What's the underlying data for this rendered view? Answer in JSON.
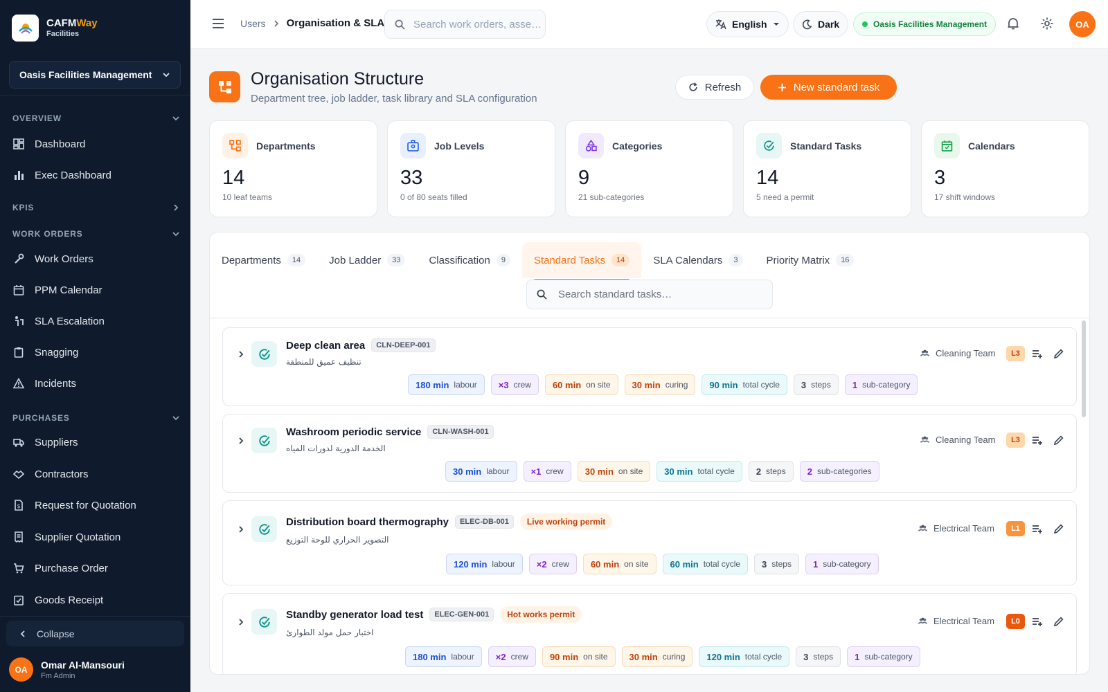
{
  "brand": {
    "name_main": "CAFM",
    "name_accent": "Way",
    "sub": "Facilities"
  },
  "sidebar": {
    "org": "Oasis Facilities Management",
    "sections": {
      "overview": "OVERVIEW",
      "kpis": "KPIS",
      "work_orders": "WORK ORDERS",
      "purchases": "PURCHASES"
    },
    "items": {
      "dashboard": "Dashboard",
      "exec_dashboard": "Exec Dashboard",
      "work_orders": "Work Orders",
      "ppm_calendar": "PPM Calendar",
      "sla_escalation": "SLA Escalation",
      "snagging": "Snagging",
      "incidents": "Incidents",
      "suppliers": "Suppliers",
      "contractors": "Contractors",
      "rfq": "Request for Quotation",
      "supplier_quotation": "Supplier Quotation",
      "purchase_order": "Purchase Order",
      "goods_receipt": "Goods Receipt"
    },
    "collapse": "Collapse",
    "user": {
      "initials": "OA",
      "name": "Omar Al-Mansouri",
      "role": "Fm Admin"
    }
  },
  "topbar": {
    "crumb_parent": "Users",
    "crumb_current": "Organisation & SLA",
    "search_placeholder": "Search work orders, asse…",
    "language": "English",
    "theme": "Dark",
    "org_badge": "Oasis Facilities Management",
    "avatar": "OA"
  },
  "page": {
    "title": "Organisation Structure",
    "subtitle": "Department tree, job ladder, task library and SLA configuration",
    "refresh": "Refresh",
    "new_task": "New standard task"
  },
  "stats": [
    {
      "label": "Departments",
      "value": "14",
      "sub": "10 leaf teams",
      "color": "#f97316",
      "bg": "#fff1e6",
      "icon": "tree-icon"
    },
    {
      "label": "Job Levels",
      "value": "33",
      "sub": "0 of 80 seats filled",
      "color": "#2563eb",
      "bg": "#e8efff",
      "icon": "badge-icon"
    },
    {
      "label": "Categories",
      "value": "9",
      "sub": "21 sub-categories",
      "color": "#7c3aed",
      "bg": "#f1eafe",
      "icon": "shapes-icon"
    },
    {
      "label": "Standard Tasks",
      "value": "14",
      "sub": "5 need a permit",
      "color": "#0d9488",
      "bg": "#e6f7f5",
      "icon": "check-circle-icon"
    },
    {
      "label": "Calendars",
      "value": "3",
      "sub": "17 shift windows",
      "color": "#16a34a",
      "bg": "#e8f8ec",
      "icon": "calendar-icon"
    }
  ],
  "tabs": [
    {
      "label": "Departments",
      "count": "14"
    },
    {
      "label": "Job Ladder",
      "count": "33"
    },
    {
      "label": "Classification",
      "count": "9"
    },
    {
      "label": "Standard Tasks",
      "count": "14"
    },
    {
      "label": "SLA Calendars",
      "count": "3"
    },
    {
      "label": "Priority Matrix",
      "count": "16"
    }
  ],
  "active_tab": "Standard Tasks",
  "task_search_placeholder": "Search standard tasks…",
  "tasks": [
    {
      "name": "Deep clean area",
      "code": "CLN-DEEP-001",
      "permit": "",
      "arabic": "تنظيف عميق للمنطقة",
      "team": "Cleaning Team",
      "level": "L3",
      "chips": [
        {
          "v": "180 min",
          "l": "labour",
          "c": "blue"
        },
        {
          "v": "×3",
          "l": "crew",
          "c": "purple"
        },
        {
          "v": "60 min",
          "l": "on site",
          "c": "orange"
        },
        {
          "v": "30 min",
          "l": "curing",
          "c": "orange"
        },
        {
          "v": "90 min",
          "l": "total cycle",
          "c": "teal"
        },
        {
          "v": "3",
          "l": "steps",
          "c": "gray"
        },
        {
          "v": "1",
          "l": "sub-category",
          "c": "purple"
        }
      ]
    },
    {
      "name": "Washroom periodic service",
      "code": "CLN-WASH-001",
      "permit": "",
      "arabic": "الخدمة الدورية لدورات المياه",
      "team": "Cleaning Team",
      "level": "L3",
      "chips": [
        {
          "v": "30 min",
          "l": "labour",
          "c": "blue"
        },
        {
          "v": "×1",
          "l": "crew",
          "c": "purple"
        },
        {
          "v": "30 min",
          "l": "on site",
          "c": "orange"
        },
        {
          "v": "30 min",
          "l": "total cycle",
          "c": "teal"
        },
        {
          "v": "2",
          "l": "steps",
          "c": "gray"
        },
        {
          "v": "2",
          "l": "sub-categories",
          "c": "purple"
        }
      ]
    },
    {
      "name": "Distribution board thermography",
      "code": "ELEC-DB-001",
      "permit": "Live working permit",
      "arabic": "التصوير الحراري للوحة التوزيع",
      "team": "Electrical Team",
      "level": "L1",
      "chips": [
        {
          "v": "120 min",
          "l": "labour",
          "c": "blue"
        },
        {
          "v": "×2",
          "l": "crew",
          "c": "purple"
        },
        {
          "v": "60 min",
          "l": "on site",
          "c": "orange"
        },
        {
          "v": "60 min",
          "l": "total cycle",
          "c": "teal"
        },
        {
          "v": "3",
          "l": "steps",
          "c": "gray"
        },
        {
          "v": "1",
          "l": "sub-category",
          "c": "purple"
        }
      ]
    },
    {
      "name": "Standby generator load test",
      "code": "ELEC-GEN-001",
      "permit": "Hot works permit",
      "arabic": "اختبار حمل مولد الطوارئ",
      "team": "Electrical Team",
      "level": "L0",
      "chips": [
        {
          "v": "180 min",
          "l": "labour",
          "c": "blue"
        },
        {
          "v": "×2",
          "l": "crew",
          "c": "purple"
        },
        {
          "v": "90 min",
          "l": "on site",
          "c": "orange"
        },
        {
          "v": "30 min",
          "l": "curing",
          "c": "orange"
        },
        {
          "v": "120 min",
          "l": "total cycle",
          "c": "teal"
        },
        {
          "v": "3",
          "l": "steps",
          "c": "gray"
        },
        {
          "v": "1",
          "l": "sub-category",
          "c": "purple"
        }
      ]
    }
  ]
}
